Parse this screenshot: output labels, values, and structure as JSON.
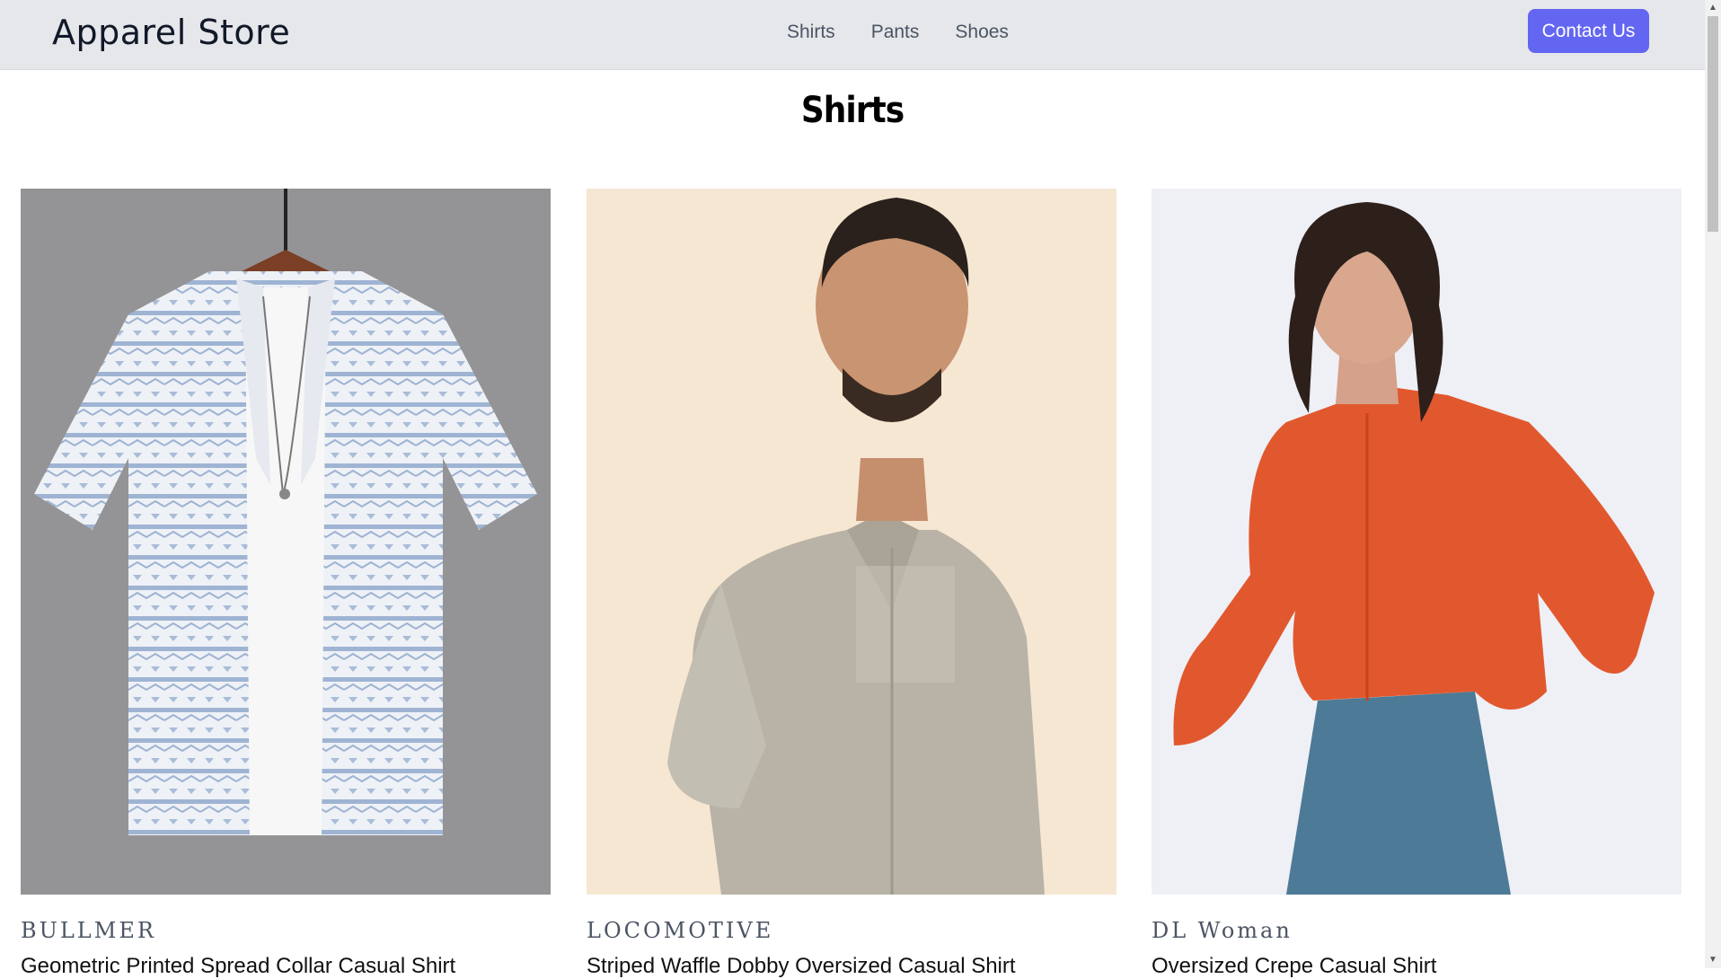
{
  "header": {
    "brand": "Apparel Store",
    "nav": [
      "Shirts",
      "Pants",
      "Shoes"
    ],
    "contact_label": "Contact Us",
    "accent_color": "#6366f1"
  },
  "page_title": "Shirts",
  "products": [
    {
      "brand": "BULLMER",
      "name": "Geometric Printed Spread Collar Casual Shirt",
      "image": "light blue patterned short-sleeve shirt on hanger"
    },
    {
      "brand": "LOCOMOTIVE",
      "name": "Striped Waffle Dobby Oversized Casual Shirt",
      "image": "man in grey waffle oversized shirt"
    },
    {
      "brand": "DL Woman",
      "name": "Oversized Crepe Casual Shirt",
      "image": "woman in orange crepe shirt and jeans"
    }
  ]
}
